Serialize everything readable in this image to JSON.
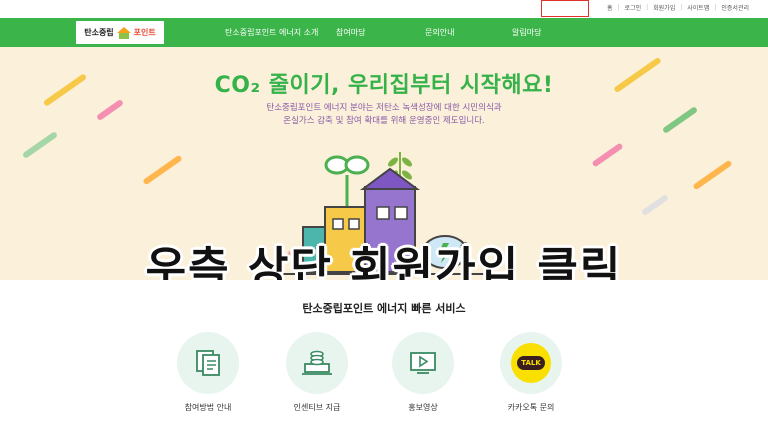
{
  "utility_links": [
    "홈",
    "로그인",
    "회원가입",
    "사이트맵",
    "인증서관리"
  ],
  "nav": {
    "logo_text": "탄소중립",
    "logo_point": "포인트",
    "items": [
      "탄소중립포인트 에너지 소개",
      "참여마당",
      "문의안내",
      "알림마당"
    ]
  },
  "hero": {
    "title": "CO₂ 줄이기, 우리집부터 시작해요!",
    "desc_line1": "탄소중립포인트 에너지 분야는 저탄소 녹색성장에 대한 시민의식과",
    "desc_line2": "온실가스 감축 및 참여 확대를 위해 운영중인 제도입니다."
  },
  "overlay_caption": "우측 상단 회원가입 클릭",
  "services": {
    "title": "탄소중립포인트 에너지 빠른 서비스",
    "items": [
      {
        "label": "참여방법 안내",
        "icon": "document-icon"
      },
      {
        "label": "인센티브 지급",
        "icon": "coins-laptop-icon"
      },
      {
        "label": "홍보영상",
        "icon": "video-play-icon"
      },
      {
        "label": "카카오톡 문의",
        "icon": "kakaotalk-icon",
        "badge": "TALK"
      }
    ]
  },
  "colors": {
    "nav_green": "#3bb54a",
    "hero_bg": "#fbf0d9",
    "title_green": "#36b24a",
    "desc_purple": "#8a5aa8",
    "highlight_red": "#e0312b",
    "kakao_yellow": "#f9e000"
  }
}
